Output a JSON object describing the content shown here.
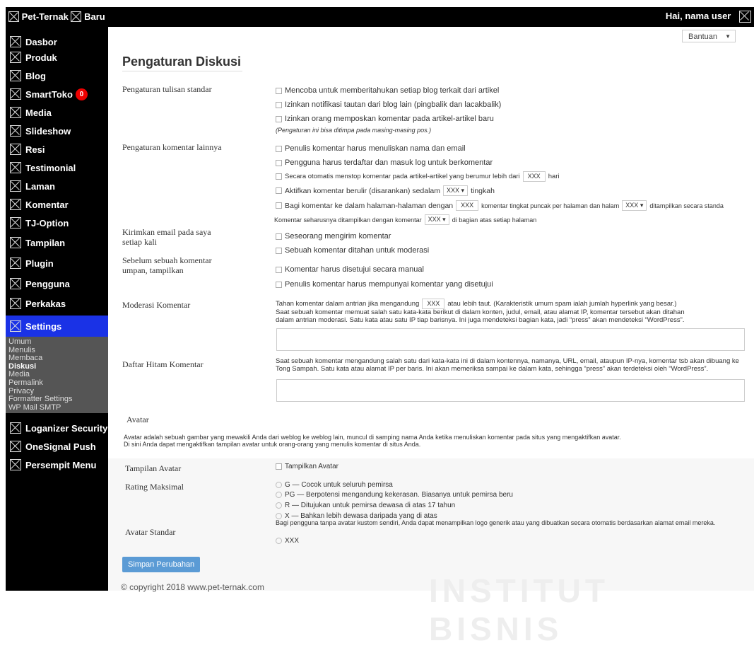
{
  "topbar": {
    "brand": "Pet-Ternak",
    "new_label": "Baru",
    "greeting": "Hai, nama user"
  },
  "sidebar": {
    "items": [
      {
        "label": "Dasbor"
      },
      {
        "label": "Produk"
      },
      {
        "label": "Blog"
      },
      {
        "label": "SmartToko",
        "badge": "0"
      },
      {
        "label": "Media"
      },
      {
        "label": "Slideshow"
      },
      {
        "label": "Resi"
      },
      {
        "label": "Testimonial"
      },
      {
        "label": "Laman"
      },
      {
        "label": "Komentar"
      },
      {
        "label": "TJ-Option"
      },
      {
        "label": "Tampilan"
      },
      {
        "label": "Plugin"
      },
      {
        "label": "Pengguna"
      },
      {
        "label": "Perkakas"
      },
      {
        "label": "Settings"
      }
    ],
    "submenu": [
      "Umum",
      "Menulis",
      "Membaca",
      "Diskusi",
      "Media",
      "Permalink",
      "Privacy",
      "Formatter Settings",
      "WP Mail SMTP"
    ],
    "bottom_items": [
      {
        "label": "Loganizer Security"
      },
      {
        "label": "OneSignal Push"
      },
      {
        "label": "Persempit Menu"
      }
    ]
  },
  "help": {
    "label": "Bantuan"
  },
  "page": {
    "title": "Pengaturan Diskusi"
  },
  "sections": {
    "standar": {
      "label": "Pengaturan tulisan standar",
      "opts": [
        "Mencoba untuk memberitahukan setiap blog terkait dari artikel",
        "Izinkan notifikasi tautan dari blog lain (pingbalik dan lacakbalik)",
        "Izinkan orang memposkan komentar pada artikel-artikel baru"
      ],
      "note": "(Pengaturan ini bisa ditimpa pada masing-masing pos.)"
    },
    "lainnya": {
      "label": "Pengaturan komentar lainnya",
      "opt1": "Penulis komentar harus menuliskan nama dan email",
      "opt2": "Pengguna harus terdaftar dan masuk log untuk berkomentar",
      "opt3_a": "Secara otomatis menstop komentar pada artikel-artikel yang berumur lebih dari",
      "opt3_val": "XXX",
      "opt3_b": "hari",
      "opt4_a": "Aktifkan komentar berulir (disarankan) sedalam",
      "opt4_val": "XXX",
      "opt4_b": "tingkah",
      "opt5_a": "Bagi komentar ke dalam halaman-halaman dengan",
      "opt5_val": "XXX",
      "opt5_b": "komentar tingkat puncak per halaman dan halam",
      "opt5_sel": "XXX",
      "opt5_c": "ditampilkan secara standa",
      "opt6_a": "Komentar seharusnya ditampilkan dengan komentar",
      "opt6_sel": "XXX",
      "opt6_b": "di bagian atas setiap halaman"
    },
    "email": {
      "label": "Kirimkan email pada saya setiap kali",
      "opts": [
        "Seseorang mengirim komentar",
        "Sebuah komentar ditahan untuk moderasi"
      ]
    },
    "sebelum": {
      "label": "Sebelum sebuah komentar umpan, tampilkan",
      "opts": [
        "Komentar harus disetujui secara manual",
        "Penulis komentar harus mempunyai komentar yang disetujui"
      ]
    },
    "moderasi": {
      "label": "Moderasi Komentar",
      "line1_a": "Tahan komentar dalam antrian jika mengandung",
      "line1_val": "XXX",
      "line1_b": "atau lebih taut. (Karakteristik umum spam ialah jumlah hyperlink yang besar.)",
      "line2": "Saat sebuah komentar memuat salah satu kata-kata berikut di dalam konten, judul, email, atau alamat IP, komentar tersebut akan ditahan",
      "line3": "dalam antrian moderasi. Satu kata atau satu IP tiap barisnya. Ini juga mendeteksi bagian kata, jadi “press” akan mendeteksi “WordPress”."
    },
    "hitam": {
      "label": "Daftar Hitam Komentar",
      "line1": "Saat sebuah komentar mengandung salah satu dari kata-kata ini di dalam kontennya, namanya, URL, email, ataupun IP-nya, komentar tsb akan dibuang ke",
      "line2": "Tong Sampah. Satu kata atau alamat IP per baris. Ini akan memeriksa sampai ke dalam kata, sehingga “press” akan terdeteksi oleh “WordPress”."
    },
    "avatar": {
      "label": "Avatar",
      "desc1": "Avatar adalah sebuah gambar yang mewakili Anda dari weblog ke weblog lain, muncul di samping nama Anda ketika menuliskan komentar pada situs yang mengaktifkan avatar.",
      "desc2": "Di sini Anda dapat mengaktifkan tampilan avatar untuk orang-orang yang menulis komentar di situs Anda.",
      "tampilan_label": "Tampilan Avatar",
      "tampilan_opt": "Tampilkan Avatar",
      "rating_label": "Rating Maksimal",
      "ratings": [
        "G — Cocok untuk seluruh pemirsa",
        "PG — Berpotensi mengandung kekerasan. Biasanya untuk pemirsa beru",
        "R — Ditujukan untuk pemirsa dewasa di atas 17 tahun",
        "X — Bahkan lebih dewasa daripada yang di atas"
      ],
      "standar_label": "Avatar Standar",
      "standar_desc": "Bagi pengguna tanpa avatar kustom sendiri, Anda dapat menampilkan logo generik atau yang dibuatkan secara otomatis berdasarkan alamat email mereka.",
      "standar_opt": "XXX"
    }
  },
  "save_label": "Simpan Perubahan",
  "footer": "© copyright 2018 www.pet-ternak.com",
  "watermark": "INSTITUT BISNIS"
}
